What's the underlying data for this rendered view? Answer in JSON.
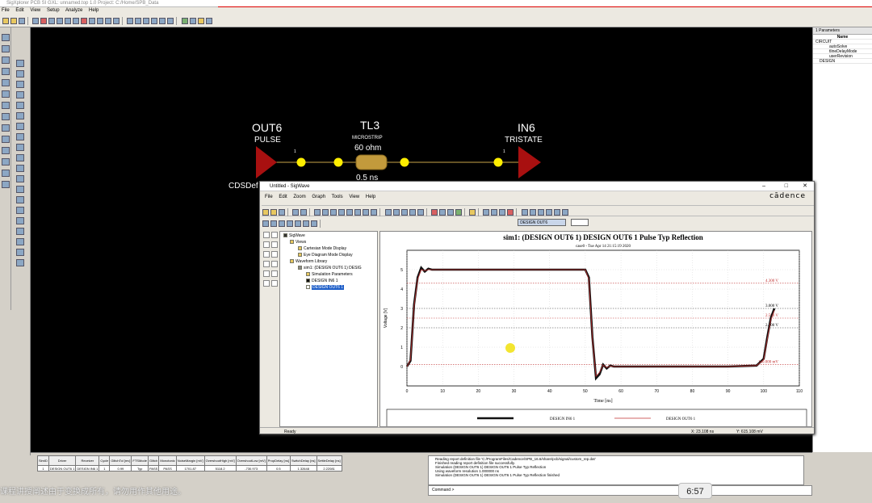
{
  "app": {
    "title": "SigXplorer PCB SI GXL: unnamed.top 1.0  Project: C:/Home/SPB_Data",
    "menu": [
      "File",
      "Edit",
      "View",
      "Setup",
      "Analyze",
      "Help"
    ]
  },
  "topology": {
    "driver": {
      "name": "OUT6",
      "model": "PULSE",
      "pin": "1"
    },
    "tline": {
      "name": "TL3",
      "type": "MICROSTRIP",
      "impedance": "60 ohm",
      "delay": "0.5 ns"
    },
    "receiver": {
      "name": "IN6",
      "model": "TRISTATE",
      "pin": "1"
    },
    "partial_label": "CDSDef"
  },
  "parameters": {
    "title": "1 Parameters",
    "header": "Name",
    "rows": [
      "CIRCUIT",
      "autoSolve",
      "tlineDelayMode",
      "userRevision",
      "DESIGN"
    ]
  },
  "sigwave": {
    "title": "Untitled - SigWave",
    "menu": [
      "File",
      "Edit",
      "Zoom",
      "Graph",
      "Tools",
      "View",
      "Help"
    ],
    "logo": "cādence",
    "tb_field": "DESIGN OUT6",
    "status_left": "Ready",
    "status_x": "X:  23.108 ns",
    "status_y": "Y:  615.108 mV",
    "tree": [
      "SigWave",
      "Views",
      "Cartesian Mode Display",
      "Eye Diagram Mode Display",
      "Waveform Library",
      "sim1: (DESIGN OUT6 1) DESIG",
      "Simulation Parameters",
      "DESIGN IN6 1",
      "DESIGN OUT6 1"
    ]
  },
  "results": {
    "headers": [
      "SimID",
      "Driver",
      "Receiver",
      "Cycle",
      "GlitchTol [mv]",
      "FTSMode",
      "Glitch",
      "Monotonic",
      "NoiseMargin [mV]",
      "OvershootHigh [mV]",
      "OvershootLow [mV]",
      "PropDelay [ns]",
      "SwitchDelay [ns]",
      "SettleDelay [ns]"
    ],
    "row": [
      "1",
      "DESIGN OUT6 1",
      "DESIGN IN6 1",
      "1",
      "0.99",
      "Typ",
      "PASS",
      "PASS",
      "1701.87",
      "5118.2",
      "-730.973",
      "0.5",
      "1.32648",
      "2.22081"
    ]
  },
  "messages": [
    "Reading report definition file 'C:/ProgramFiles/Cadence/SPB_16.6/share/pcb/signal/custom_rep.dat'",
    "Finished reading report definition file successfully.",
    "Simulation (DESIGN OUT6 1) DESIGN OUT6 1 Pulse Typ Reflection",
    "Using waveform resolution 1.000000 ns",
    "Simulation (DESIGN OUT6 1) DESIGN OUT6 1 Pulse Typ Reflection finished"
  ],
  "command_prompt": "Command >",
  "overlay": {
    "subtitle": "课程讲授阐述由于变换成所有，请勿用作其他用途。",
    "timestamp": "6:57"
  },
  "colors": {
    "canvas": "#000000",
    "component": "#b01010",
    "node": "#ffee00",
    "tline": "#d4a020",
    "waveform_main": "#111111",
    "waveform_secondary": "#c03030"
  },
  "chart_data": {
    "type": "line",
    "title": "sim1: (DESIGN OUT6 1) DESIGN OUT6 1 Pulse Typ Reflection",
    "subtitle": "case0 - Tue Apr 14 21:15:19 2020",
    "xlabel": "Time [ns]",
    "ylabel": "Voltage [V]",
    "xlim": [
      0,
      110
    ],
    "ylim": [
      -1,
      6
    ],
    "xticks": [
      0,
      10,
      20,
      30,
      40,
      50,
      60,
      70,
      80,
      90,
      100,
      110
    ],
    "yticks": [
      0,
      1,
      2,
      3,
      4,
      5
    ],
    "grid": true,
    "reference_lines": [
      {
        "y": 4.3,
        "label": "4.300 V",
        "color": "#c03030"
      },
      {
        "y": 3.0,
        "label": "3.000 V",
        "color": "#444444"
      },
      {
        "y": 2.5,
        "label": "2.500 V",
        "color": "#c03030"
      },
      {
        "y": 2.0,
        "label": "2.000 V",
        "color": "#444444"
      },
      {
        "y": 0.1,
        "label": "100.000 mV",
        "color": "#c03030"
      }
    ],
    "series": [
      {
        "name": "DESIGN IN6 1",
        "style": "thick",
        "x": [
          0,
          1,
          2,
          3,
          4,
          5,
          6,
          7,
          8,
          10,
          20,
          30,
          40,
          50,
          51,
          52,
          53,
          54,
          55,
          56,
          57,
          58,
          60,
          70,
          80,
          90,
          98,
          100,
          101,
          102,
          103
        ],
        "y": [
          0,
          0.3,
          3.2,
          4.6,
          5.1,
          4.9,
          5.05,
          5.0,
          5.0,
          5.0,
          5.0,
          5.0,
          5.0,
          5.0,
          4.6,
          1.5,
          -0.6,
          -0.4,
          0.1,
          -0.1,
          0.05,
          0,
          0,
          0,
          0,
          0,
          0.05,
          0.4,
          1.5,
          2.5,
          3.0
        ]
      },
      {
        "name": "DESIGN OUT6 1",
        "style": "thin",
        "x": [
          0,
          1,
          2,
          3,
          4,
          5,
          6,
          7,
          8,
          10,
          20,
          30,
          40,
          50,
          51,
          52,
          53,
          54,
          55,
          56,
          57,
          58,
          60,
          70,
          80,
          90,
          98,
          100,
          101,
          102,
          103
        ],
        "y": [
          0,
          0.35,
          3.1,
          4.5,
          5.0,
          4.95,
          5.0,
          5.0,
          5.0,
          5.0,
          5.0,
          5.0,
          5.0,
          5.0,
          4.5,
          1.4,
          -0.5,
          -0.3,
          0.08,
          -0.05,
          0.03,
          0,
          0,
          0,
          0,
          0,
          0.05,
          0.35,
          1.4,
          2.4,
          2.9
        ]
      }
    ]
  }
}
